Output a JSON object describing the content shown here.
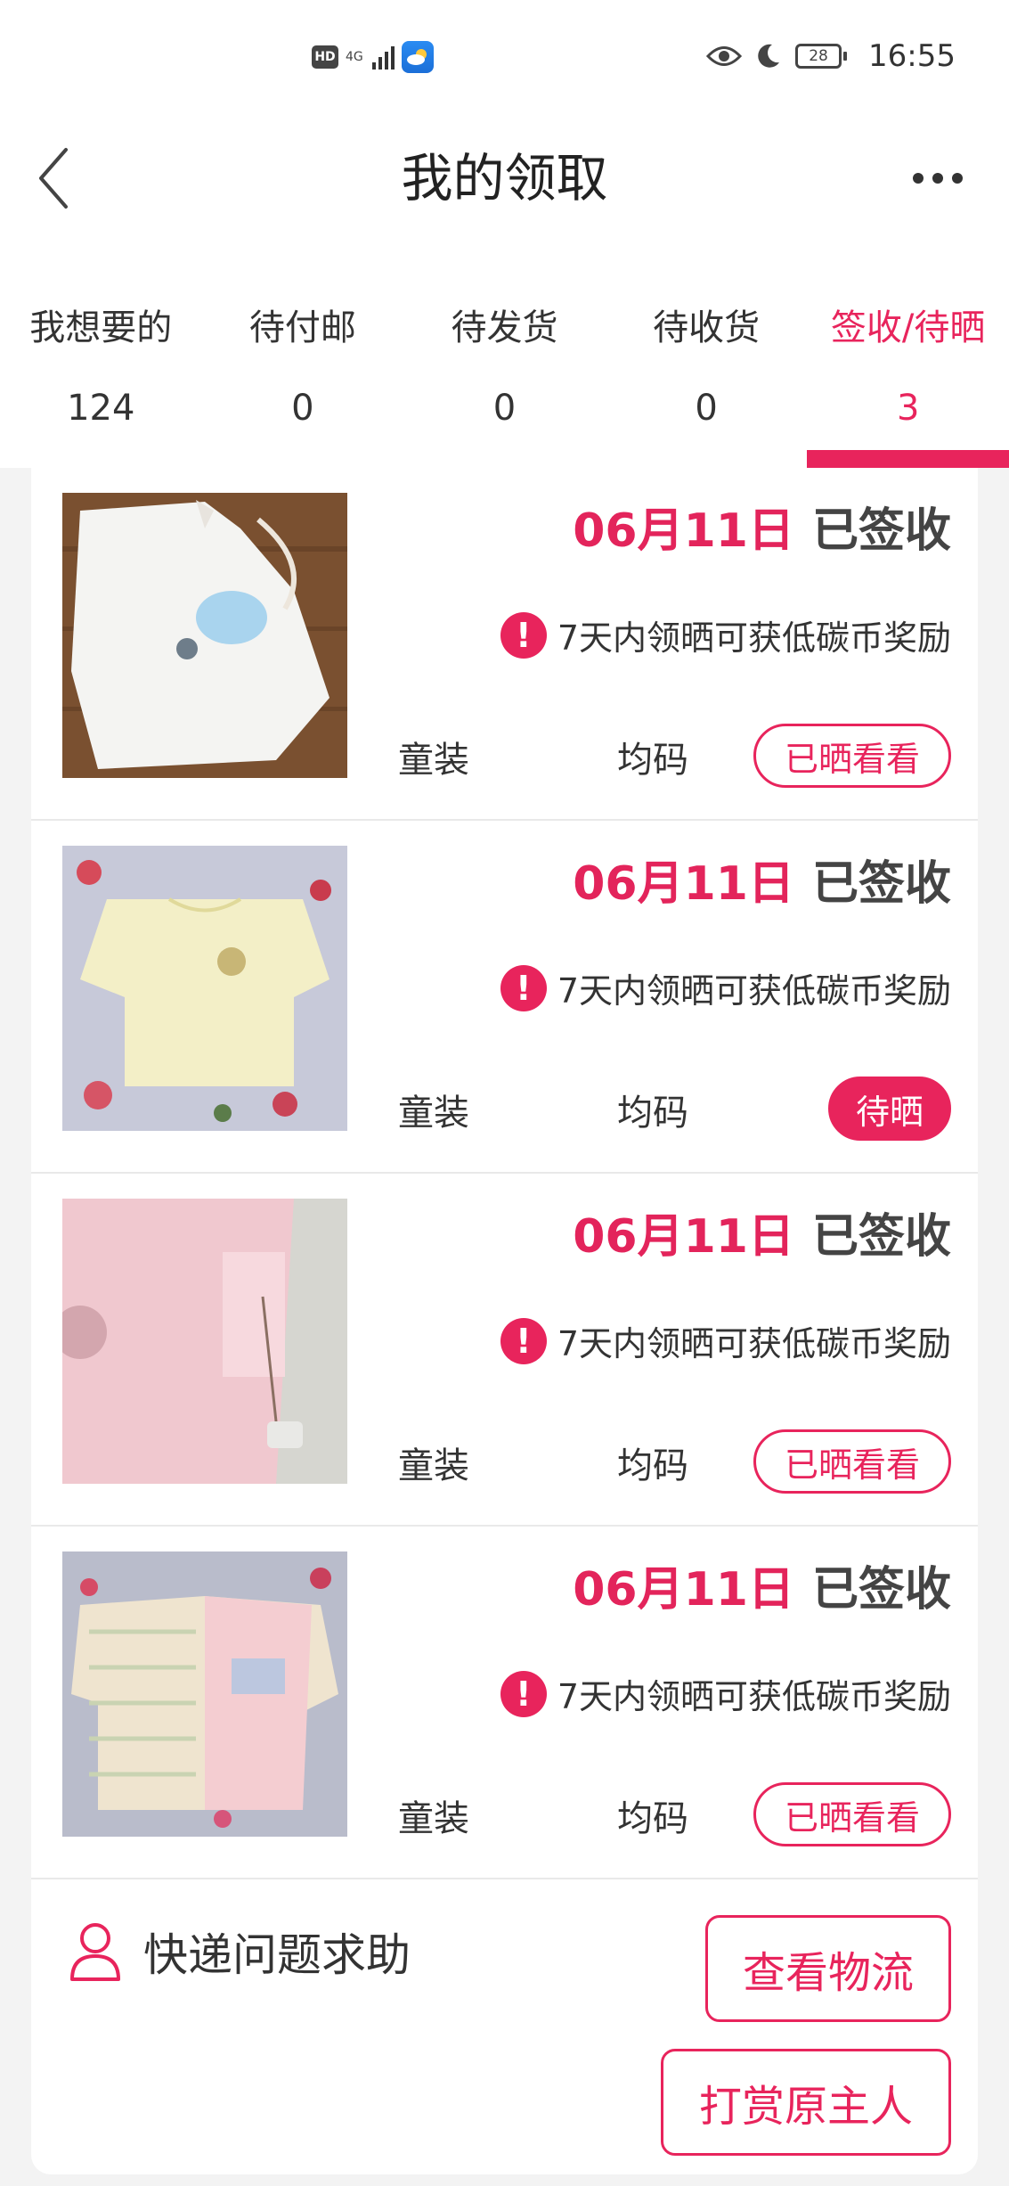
{
  "status_bar": {
    "hd": "HD",
    "network": "4G",
    "battery": "28",
    "time": "16:55"
  },
  "header": {
    "title": "我的领取"
  },
  "tabs": [
    {
      "label": "我想要的",
      "count": "124"
    },
    {
      "label": "待付邮",
      "count": "0"
    },
    {
      "label": "待发货",
      "count": "0"
    },
    {
      "label": "待收货",
      "count": "0"
    },
    {
      "label": "签收/待晒",
      "count": "3"
    }
  ],
  "active_tab": "签收/待晒",
  "items": [
    {
      "date": "06月11日",
      "status": "已签收",
      "notice": "7天内领晒可获低碳币奖励",
      "category": "童装",
      "size": "均码",
      "action": "已晒看看",
      "action_style": "outline"
    },
    {
      "date": "06月11日",
      "status": "已签收",
      "notice": "7天内领晒可获低碳币奖励",
      "category": "童装",
      "size": "均码",
      "action": "待晒",
      "action_style": "filled"
    },
    {
      "date": "06月11日",
      "status": "已签收",
      "notice": "7天内领晒可获低碳币奖励",
      "category": "童装",
      "size": "均码",
      "action": "已晒看看",
      "action_style": "outline"
    },
    {
      "date": "06月11日",
      "status": "已签收",
      "notice": "7天内领晒可获低碳币奖励",
      "category": "童装",
      "size": "均码",
      "action": "已晒看看",
      "action_style": "outline"
    }
  ],
  "footer": {
    "help_label": "快递问题求助",
    "logistics_button": "查看物流",
    "reward_button": "打赏原主人"
  },
  "colors": {
    "accent": "#e8245c",
    "text": "#333333",
    "background": "#f3f3f3"
  },
  "icons": {
    "back": "chevron-left-icon",
    "more": "more-dots-icon",
    "warning": "exclamation-circle-icon",
    "help": "person-icon"
  }
}
